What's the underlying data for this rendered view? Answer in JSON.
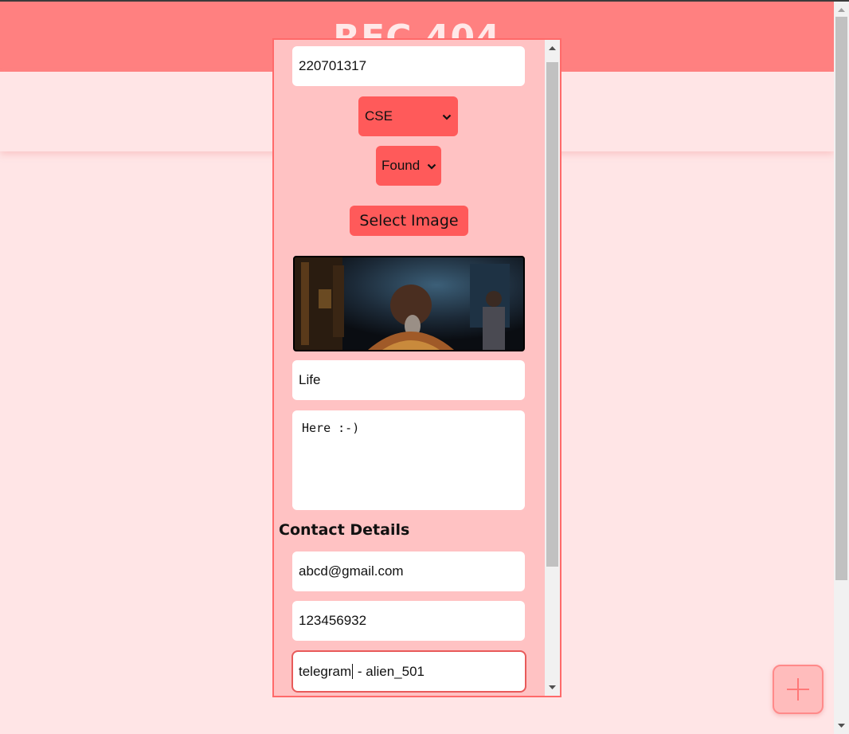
{
  "header": {
    "title": "REC 404"
  },
  "form": {
    "register_number": "220701317",
    "department": {
      "selected": "CSE"
    },
    "status": {
      "selected": "Found"
    },
    "select_image_label": "Select Image",
    "item_name": "Life",
    "description": "Here :-)",
    "contact_heading": "Contact Details",
    "email": "abcd@gmail.com",
    "phone": "123456932",
    "other_contact_before_caret": "telegram",
    "other_contact_after_caret": " - alien_501"
  },
  "icons": {
    "chevron": "chevron-down-icon",
    "fab": "plus-icon",
    "scroll_up": "scroll-up-arrow-icon",
    "scroll_down": "scroll-down-arrow-icon"
  },
  "colors": {
    "header": "#ff8080",
    "page_bg": "#ffe5e6",
    "modal_bg": "#ffc2c3",
    "accent": "#ff5a5a"
  }
}
